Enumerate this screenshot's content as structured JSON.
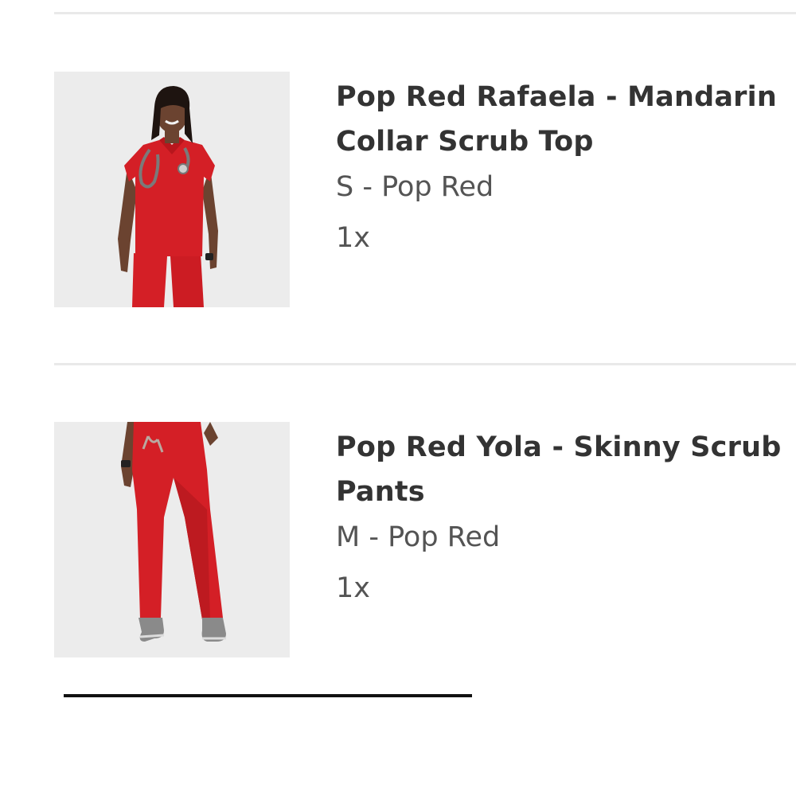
{
  "order_items": [
    {
      "title": "Pop Red Rafaela - Mandarin Collar Scrub Top",
      "variant": "S - Pop Red",
      "quantity": "1x",
      "image_icon": "product-photo-scrub-top"
    },
    {
      "title": "Pop Red Yola - Skinny Scrub Pants",
      "variant": "M - Pop Red",
      "quantity": "1x",
      "image_icon": "product-photo-scrub-pants"
    }
  ],
  "colors": {
    "product_red": "#d41f26",
    "thumb_background": "#ececec",
    "divider": "#e9e9e9",
    "title_text": "#333333",
    "meta_text": "#545454"
  }
}
